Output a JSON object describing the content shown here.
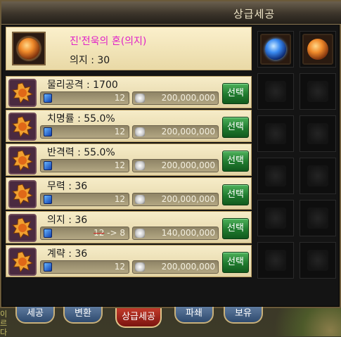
{
  "window": {
    "title": "상급세공"
  },
  "item": {
    "name": "진'전욱의 혼(의지)",
    "stat": "의지 : 30"
  },
  "rows": [
    {
      "label": "물리공격 : 1700",
      "gem_value": "12",
      "gem_strike": false,
      "cost": "200,000,000",
      "button": "선택"
    },
    {
      "label": "치명률 : 55.0%",
      "gem_value": "12",
      "gem_strike": false,
      "cost": "200,000,000",
      "button": "선택"
    },
    {
      "label": "반격력 : 55.0%",
      "gem_value": "12",
      "gem_strike": false,
      "cost": "200,000,000",
      "button": "선택"
    },
    {
      "label": "무력 : 36",
      "gem_value": "12",
      "gem_strike": false,
      "cost": "200,000,000",
      "button": "선택"
    },
    {
      "label": "의지 : 36",
      "gem_value_old": "12",
      "gem_value_new": " -> 8",
      "gem_strike": true,
      "cost": "140,000,000",
      "button": "선택"
    },
    {
      "label": "계략 : 36",
      "gem_value": "12",
      "gem_strike": false,
      "cost": "200,000,000",
      "button": "선택"
    }
  ],
  "tabs": [
    {
      "label": "세공",
      "active": false
    },
    {
      "label": "변환",
      "active": false
    },
    {
      "label": "상급세공",
      "active": true
    },
    {
      "label": "파쇄",
      "active": false
    },
    {
      "label": "보유",
      "active": false
    }
  ],
  "background_text": "이\n르\n다"
}
